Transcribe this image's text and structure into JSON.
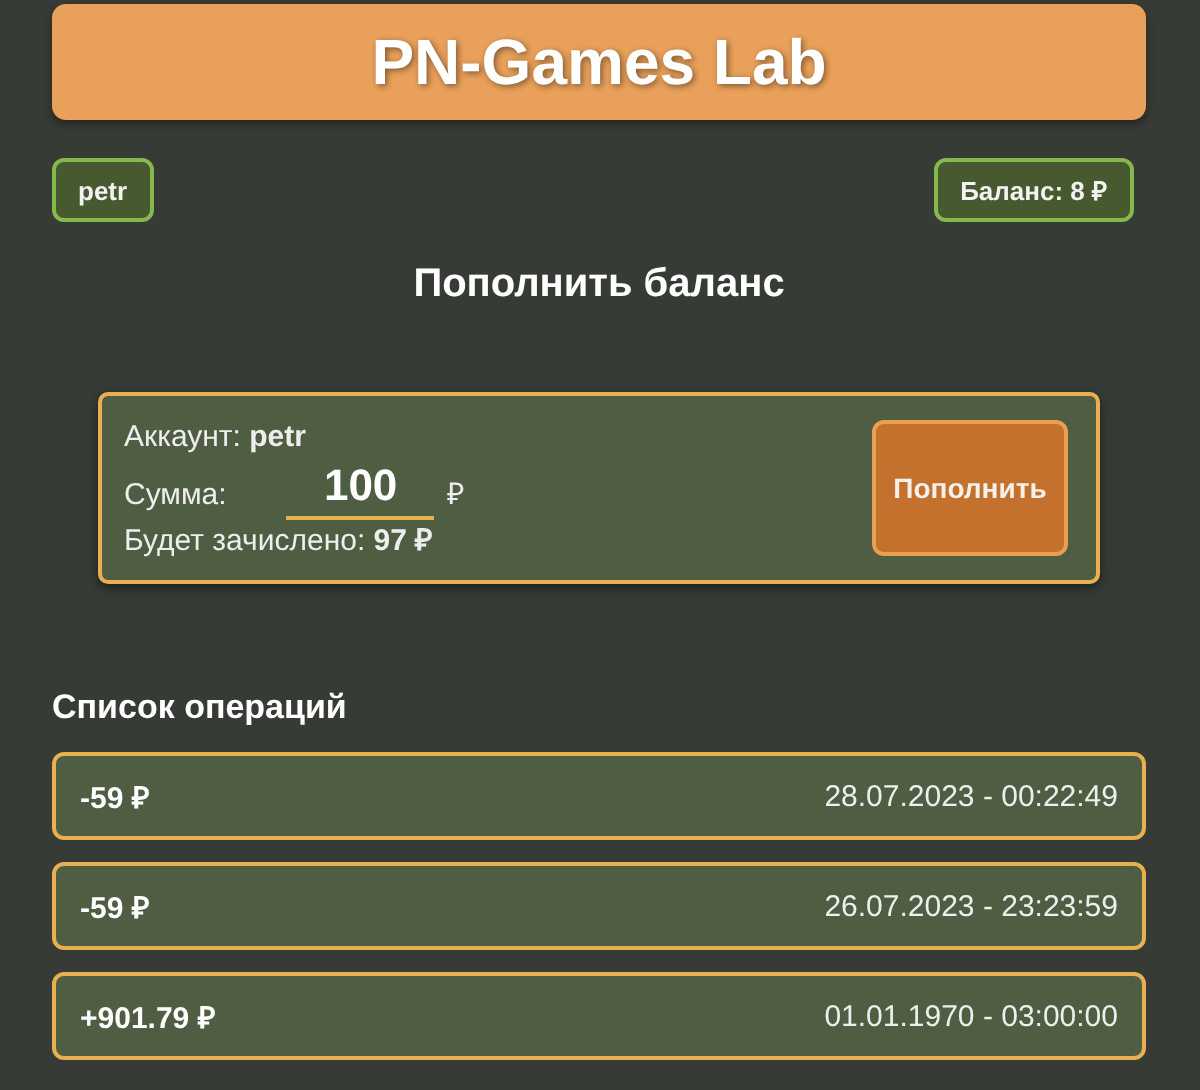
{
  "header": {
    "title": "PN-Games Lab"
  },
  "user_chip": "petr",
  "balance_chip": "Баланс: 8 ₽",
  "page_title": "Пополнить баланс",
  "topup": {
    "account": "Аккаунт: **petr**",
    "amount_label": "Сумма:",
    "amount_value": "100",
    "currency": "₽",
    "credited": "Будет зачислено: **97 ₽**",
    "button": "Пополнить"
  },
  "operations_title": "Список операций",
  "operations": [
    {
      "amount": "-59 ₽",
      "datetime": "28.07.2023 - 00:22:49"
    },
    {
      "amount": "-59 ₽",
      "datetime": "26.07.2023 - 23:23:59"
    },
    {
      "amount": "+901.79 ₽",
      "datetime": "01.01.1970 - 03:00:00"
    }
  ]
}
